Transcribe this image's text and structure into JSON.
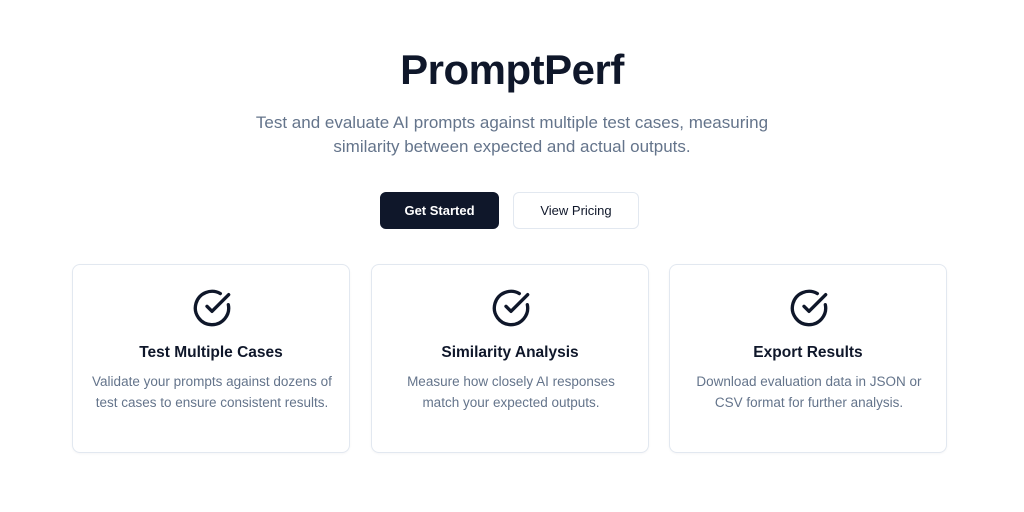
{
  "hero": {
    "title": "PromptPerf",
    "subtitle": "Test and evaluate AI prompts against multiple test cases, measuring similarity between expected and actual outputs."
  },
  "actions": {
    "primary_label": "Get Started",
    "secondary_label": "View Pricing"
  },
  "features": [
    {
      "icon": "check-circle-icon",
      "title": "Test Multiple Cases",
      "description": "Validate your prompts against dozens of test cases to ensure consistent results."
    },
    {
      "icon": "check-circle-icon",
      "title": "Similarity Analysis",
      "description": "Measure how closely AI responses match your expected outputs."
    },
    {
      "icon": "check-circle-icon",
      "title": "Export Results",
      "description": "Download evaluation data in JSON or CSV format for further analysis."
    }
  ],
  "colors": {
    "primary": "#0f172a",
    "muted_text": "#64748b",
    "border": "#e2e8f0",
    "background": "#ffffff"
  }
}
